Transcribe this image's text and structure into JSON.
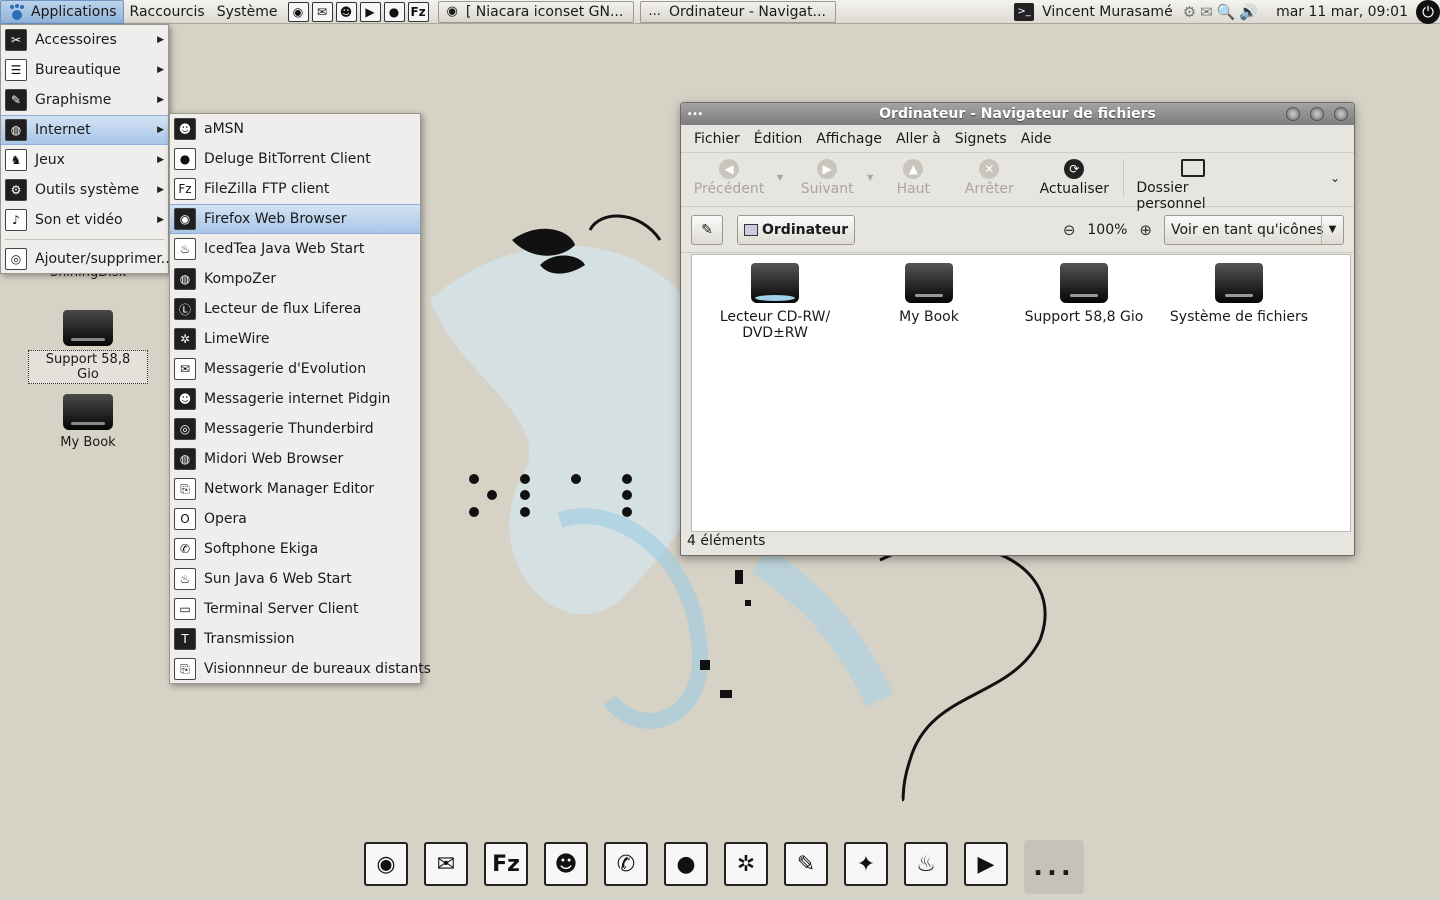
{
  "top_panel": {
    "menus": [
      "Applications",
      "Raccourcis",
      "Système"
    ],
    "launchers": [
      {
        "icon": "firefox-icon",
        "glyph": "◉"
      },
      {
        "icon": "mail-icon",
        "glyph": "✉"
      },
      {
        "icon": "pidgin-icon",
        "glyph": "☻"
      },
      {
        "icon": "media-player-icon",
        "glyph": "▶"
      },
      {
        "icon": "deluge-icon",
        "glyph": "●"
      },
      {
        "icon": "filezilla-icon",
        "glyph": "Fz"
      }
    ],
    "tasks": [
      {
        "icon": "◉",
        "label": "[ Niacara iconset GN..."
      },
      {
        "icon": "...",
        "label": "Ordinateur - Navigat..."
      }
    ],
    "user_name": "Vincent Murasamé",
    "tray_glyphs": [
      "⚙",
      "✉",
      "🔍",
      "🔊"
    ],
    "clock": "mar 11 mar, 09:01"
  },
  "applications_menu": {
    "items": [
      {
        "label": "Accessoires",
        "icon": "accessories-icon",
        "glyph": "✂",
        "submenu": true
      },
      {
        "label": "Bureautique",
        "icon": "office-icon",
        "glyph": "☰",
        "submenu": true
      },
      {
        "label": "Graphisme",
        "icon": "graphics-icon",
        "glyph": "✎",
        "submenu": true
      },
      {
        "label": "Internet",
        "icon": "internet-icon",
        "glyph": "◍",
        "submenu": true,
        "highlighted": true
      },
      {
        "label": "Jeux",
        "icon": "games-icon",
        "glyph": "♞",
        "submenu": true
      },
      {
        "label": "Outils système",
        "icon": "system-tools-icon",
        "glyph": "⚙",
        "submenu": true
      },
      {
        "label": "Son et vidéo",
        "icon": "sound-video-icon",
        "glyph": "♪",
        "submenu": true
      }
    ],
    "footer_item": "Ajouter/supprimer..."
  },
  "internet_menu": {
    "items": [
      {
        "label": "aMSN",
        "glyph": "☻"
      },
      {
        "label": "Deluge BitTorrent Client",
        "glyph": "●"
      },
      {
        "label": "FileZilla FTP client",
        "glyph": "Fz"
      },
      {
        "label": "Firefox Web Browser",
        "glyph": "◉",
        "highlighted": true
      },
      {
        "label": "IcedTea Java  Web Start",
        "glyph": "♨"
      },
      {
        "label": "KompoZer",
        "glyph": "◍"
      },
      {
        "label": "Lecteur de flux Liferea",
        "glyph": "Ⓛ"
      },
      {
        "label": "LimeWire",
        "glyph": "✲"
      },
      {
        "label": "Messagerie d'Evolution",
        "glyph": "✉"
      },
      {
        "label": "Messagerie internet Pidgin",
        "glyph": "☻"
      },
      {
        "label": "Messagerie Thunderbird",
        "glyph": "◎"
      },
      {
        "label": "Midori Web Browser",
        "glyph": "◍"
      },
      {
        "label": "Network Manager Editor",
        "glyph": "⎘"
      },
      {
        "label": "Opera",
        "glyph": "O"
      },
      {
        "label": "Softphone Ekiga",
        "glyph": "✆"
      },
      {
        "label": "Sun Java 6 Web Start",
        "glyph": "♨"
      },
      {
        "label": "Terminal Server Client",
        "glyph": "▭"
      },
      {
        "label": "Transmission",
        "glyph": "T"
      },
      {
        "label": "Visionnneur de bureaux distants",
        "glyph": "⎘"
      }
    ]
  },
  "desktop": {
    "partial_label": "ShiningDisk",
    "icons": [
      {
        "label": "Support 58,8 Gio",
        "selected": true
      },
      {
        "label": "My Book",
        "selected": false
      }
    ]
  },
  "file_window": {
    "title": "Ordinateur - Navigateur de fichiers",
    "title_menu": "...",
    "menubar": [
      "Fichier",
      "Édition",
      "Affichage",
      "Aller à",
      "Signets",
      "Aide"
    ],
    "toolbar": {
      "back": "Précédent",
      "forward": "Suivant",
      "up": "Haut",
      "stop": "Arrêter",
      "reload": "Actualiser",
      "home": "Dossier personnel"
    },
    "location": "Ordinateur",
    "zoom": "100%",
    "view_mode": "Voir en tant qu'icônes",
    "items": [
      {
        "label": "Lecteur CD-RW/ DVD±RW",
        "type": "cd"
      },
      {
        "label": "My Book",
        "type": "hd"
      },
      {
        "label": "Support 58,8 Gio",
        "type": "hd"
      },
      {
        "label": "Système de fichiers",
        "type": "hd"
      }
    ],
    "status": "4 éléments"
  },
  "dock": [
    {
      "icon": "firefox-icon",
      "glyph": "◉"
    },
    {
      "icon": "mail-icon",
      "glyph": "✉"
    },
    {
      "icon": "filezilla-icon",
      "glyph": "Fz"
    },
    {
      "icon": "pidgin-icon",
      "glyph": "☻"
    },
    {
      "icon": "ekiga-icon",
      "glyph": "✆"
    },
    {
      "icon": "deluge-icon",
      "glyph": "●"
    },
    {
      "icon": "limewire-icon",
      "glyph": "✲"
    },
    {
      "icon": "gimp-icon",
      "glyph": "✎"
    },
    {
      "icon": "inkscape-icon",
      "glyph": "✦"
    },
    {
      "icon": "burner-icon",
      "glyph": "♨"
    },
    {
      "icon": "media-player-icon",
      "glyph": "▶"
    }
  ],
  "dock_more": "..."
}
